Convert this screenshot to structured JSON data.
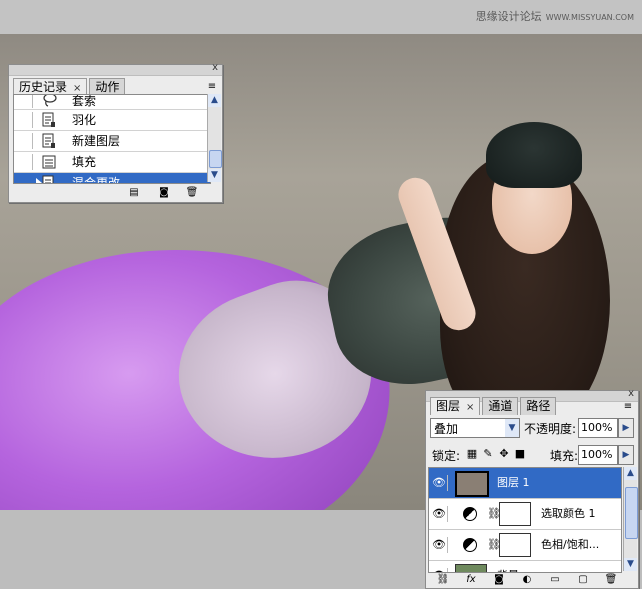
{
  "watermark": {
    "cn": "思缘设计论坛",
    "url": "WWW.MISSYUAN.COM"
  },
  "history_panel": {
    "tabs": [
      {
        "label": "历史记录",
        "close": "×"
      },
      {
        "label": "动作"
      }
    ],
    "items": [
      {
        "label": "套索"
      },
      {
        "label": "羽化"
      },
      {
        "label": "新建图层"
      },
      {
        "label": "填充"
      },
      {
        "label": "混合更改",
        "selected": true
      }
    ]
  },
  "layers_panel": {
    "tabs": [
      {
        "label": "图层",
        "close": "×"
      },
      {
        "label": "通道"
      },
      {
        "label": "路径"
      }
    ],
    "blend_mode": "叠加",
    "opacity_label": "不透明度:",
    "opacity_value": "100%",
    "lock_label": "锁定:",
    "fill_label": "填充:",
    "fill_value": "100%",
    "layers": [
      {
        "name": "图层 1",
        "selected": true
      },
      {
        "name": "选取颜色 1",
        "type": "adjustment"
      },
      {
        "name": "色相/饱和...",
        "type": "adjustment"
      },
      {
        "name": "背景",
        "type": "background"
      }
    ]
  },
  "icons": {
    "eye": "eye-icon",
    "menu": "panel-menu-icon",
    "lasso": "lasso-icon",
    "history_state": "history-state-icon"
  },
  "colors": {
    "selection": "#316ac5",
    "panel": "#ececec"
  }
}
